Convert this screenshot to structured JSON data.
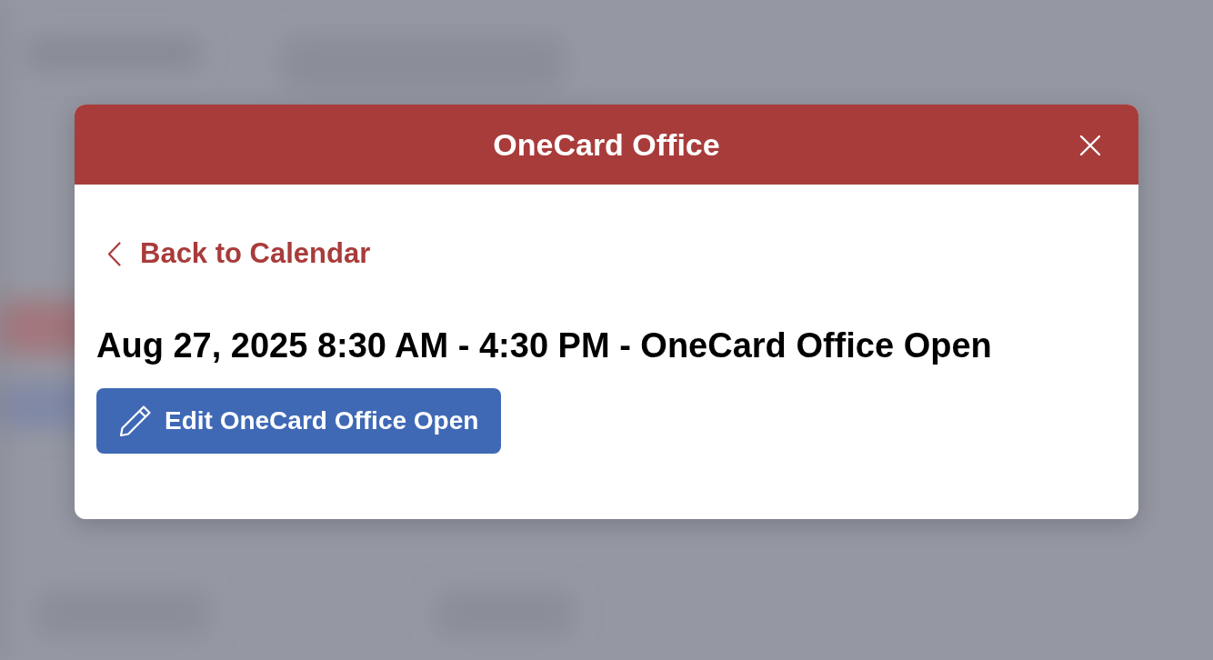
{
  "modal": {
    "title": "OneCard Office",
    "back_link": "Back to Calendar",
    "event_heading": "Aug 27, 2025 8:30 AM - 4:30 PM - OneCard Office Open",
    "edit_button": "Edit OneCard Office Open"
  }
}
